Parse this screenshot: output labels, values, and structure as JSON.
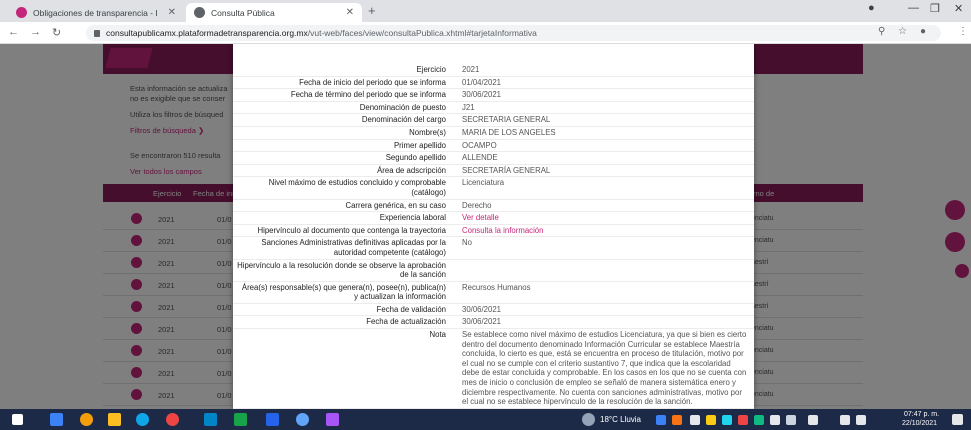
{
  "browser": {
    "tabs": [
      {
        "title": "Obligaciones de transparencia - I",
        "close": "✕"
      },
      {
        "title": "Consulta Pública",
        "close": "✕"
      }
    ],
    "new_tab": "+",
    "url_host": "consultapublicamx.plataformadetransparencia.org.mx",
    "url_path": "/vut-web/faces/view/consultaPublica.xhtml#tarjetaInformativa"
  },
  "background": {
    "lines": [
      "Esta información se actualiza",
      "no es exigible que se conser",
      "Utiliza los filtros de búsqued",
      "Filtros de búsqueda ❯",
      "Se encontraron 510 resulta",
      "Ver todos los campos"
    ],
    "table_headers": [
      "Ejercicio",
      "Fecha de ini",
      "rno de"
    ],
    "rows": [
      {
        "year": "2021",
        "date": "01/0",
        "right": "enciatu"
      },
      {
        "year": "2021",
        "date": "01/0",
        "right": "enciatu"
      },
      {
        "year": "2021",
        "date": "01/0",
        "right": "aestrí"
      },
      {
        "year": "2021",
        "date": "01/0",
        "right": "aestrí"
      },
      {
        "year": "2021",
        "date": "01/0",
        "right": "aestrí"
      },
      {
        "year": "2021",
        "date": "01/0",
        "right": "enciatu"
      },
      {
        "year": "2021",
        "date": "01/0",
        "right": "enciatu"
      },
      {
        "year": "2021",
        "date": "01/0",
        "right": "enciatu"
      },
      {
        "year": "2021",
        "date": "01/0",
        "right": "enciatu"
      }
    ]
  },
  "modal": {
    "fields": [
      {
        "label": "Ejercicio",
        "value": "2021"
      },
      {
        "label": "Fecha de inicio del periodo que se informa",
        "value": "01/04/2021"
      },
      {
        "label": "Fecha de término del periodo que se informa",
        "value": "30/06/2021"
      },
      {
        "label": "Denominación de puesto",
        "value": "J21"
      },
      {
        "label": "Denominación del cargo",
        "value": "SECRETARIA GENERAL"
      },
      {
        "label": "Nombre(s)",
        "value": "MARIA DE LOS ANGELES"
      },
      {
        "label": "Primer apellido",
        "value": "OCAMPO"
      },
      {
        "label": "Segundo apellido",
        "value": "ALLENDE"
      },
      {
        "label": "Área de adscripción",
        "value": "SECRETARÍA GENERAL"
      },
      {
        "label": "Nivel máximo de estudios concluido y comprobable (catálogo)",
        "value": "Licenciatura"
      },
      {
        "label": "Carrera genérica, en su caso",
        "value": "Derecho"
      },
      {
        "label": "Experiencia laboral",
        "value": "Ver detalle",
        "link": true
      },
      {
        "label": "Hipervínculo al documento que contenga la trayectoria",
        "value": "Consulta la información",
        "link": true
      },
      {
        "label": "Sanciones Administrativas definitivas aplicadas por la autoridad competente (catálogo)",
        "value": "No"
      },
      {
        "label": "Hipervínculo a la resolución donde se observe la aprobación de la sanción",
        "value": ""
      },
      {
        "label": "Área(s) responsable(s) que genera(n), posee(n), publica(n) y actualizan la información",
        "value": "Recursos Humanos"
      },
      {
        "label": "Fecha de validación",
        "value": "30/06/2021"
      },
      {
        "label": "Fecha de actualización",
        "value": "30/06/2021"
      },
      {
        "label": "Nota",
        "value": "Se establece como nivel máximo de estudios Licenciatura, ya que si bien es cierto dentro del documento denominado Información Curricular se establece Maestría concluida, lo cierto es que, está se encuentra en proceso de titulación, motivo por el cual no se cumple con el criterio sustantivo 7, que indica que la escolaridad debe de estar concluida y comprobable. En los casos en los que no se cuenta con mes de inicio o conclusión de empleo se señaló de manera sistemática enero y diciembre respectivamente. No cuenta con sanciones administrativas, motivo por el cual no se establece hipervínculo de la resolución de la sanción."
      }
    ]
  },
  "taskbar": {
    "weather": "18°C  Lluvia",
    "time": "07:47 p. m.",
    "date": "22/10/2021"
  },
  "colors": {
    "accent": "#c4277a",
    "brand": "#8a1c5a"
  }
}
